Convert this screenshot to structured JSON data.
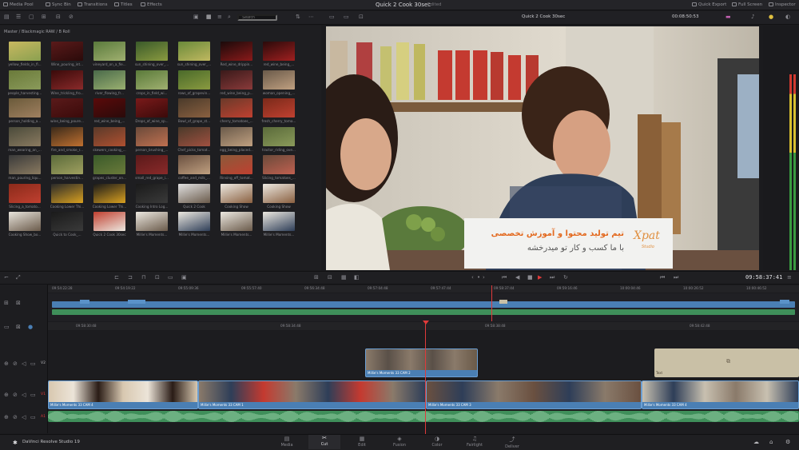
{
  "topbar": {
    "media_pool": "Media Pool",
    "sync_bin": "Sync Bin",
    "transitions": "Transitions",
    "titles": "Titles",
    "effects": "Effects",
    "project_title": "Quick 2 Cook 30sec",
    "edited": "Edited",
    "quick_export": "Quick Export",
    "full_screen": "Full Screen",
    "inspector": "Inspector"
  },
  "toolbar": {
    "search_placeholder": "Search",
    "viewer_clip": "Quick 2 Cook 30sec",
    "viewer_timecode": "00:08:50:53"
  },
  "pool": {
    "path": "Master / Blackmagic RAW / B Roll",
    "clips": [
      "yellow_fields_in_fl...",
      "Wine_pouring_int...",
      "vineyard_on_a_fie...",
      "sun_shining_over_...",
      "sun_shining_over_...",
      "Red_wine_drippin...",
      "red_wine_being_...",
      "people_harvesting...",
      "Wine_trickling_fro...",
      "river_flowing_fr...",
      "crops_in_field_wi...",
      "rows_of_grapevin...",
      "red_wine_being_p...",
      "woman_opening_...",
      "person_holding_a...",
      "wine_being_poure...",
      "red_wine_being_...",
      "Drops_of_wine_sp...",
      "Bowl_of_grape_st...",
      "cherry_tomatoes_...",
      "fresh_cherry_toma...",
      "man_wearing_an_...",
      "fire_and_smoke_r...",
      "skewers_cooking_...",
      "person_brushing_...",
      "Chef_picks_tomat...",
      "egg_being_placed...",
      "tractor_riding_ove...",
      "man_pouring_liqu...",
      "person_harvestin...",
      "grapes_cluster_on...",
      "small_red_grape_i...",
      "coffee_and_milk_...",
      "Rinsing_off_tomat...",
      "Slicing_tomatoes_...",
      "Slicing_a_tomato...",
      "Cooking Lower Thi...",
      "Cooking Lower Thi...",
      "Cooking Intro Log...",
      "Quick 2 Cook",
      "Cooking Show",
      "Cooking Show",
      "Cooking Show_bo...",
      "Quick to Cook_...",
      "Quick 2 Cook 30sec",
      "Millie's Moments...",
      "Millie's Moments...",
      "Millie's Moments...",
      "Millie's Moments..."
    ]
  },
  "overlay": {
    "line1": "تیم تولید محتوا و آموزش تخصصی",
    "line2": "با ما کسب و کار تو  میدرخشه",
    "logo": "Xpat",
    "logo_sub": "Studio"
  },
  "transport": {
    "timecode": "09:58:37:41"
  },
  "ruler_top": [
    "09:54:22:28",
    "09:54:19:22",
    "09:55:09:36",
    "09:55:57:40",
    "09:56:34:48",
    "09:57:04:48",
    "09:57:47:44",
    "09:58:37:44",
    "09:59:16:46",
    "10:00:04:46",
    "10:00:26:52",
    "10:00:46:52"
  ],
  "ruler_main": [
    "09:58:30:48",
    "09:58:34:48",
    "09:58:38:48",
    "09:58:42:48"
  ],
  "tracks": {
    "v2": "V2",
    "v1": "V1",
    "a1": "A1",
    "clip_v2": "Millie's Moments 33 CAM 2",
    "clip_v1a": "Millie's Moments 33 CAM 4",
    "clip_v1b": "Millie's Moments 33 CAM 1",
    "clip_v1c": "Millie's Moments 33 CAM 3",
    "clip_v1d": "Millie's Moments 33 CAM 4",
    "clip_text": "Text"
  },
  "bottom": {
    "app_name": "DaVinci Resolve Studio 19",
    "pages": [
      "Media",
      "Cut",
      "Edit",
      "Fusion",
      "Color",
      "Fairlight",
      "Deliver"
    ]
  },
  "colors": {
    "accent_red": "#e03a3a",
    "clip_blue": "#4a7fb4",
    "audio_green": "#3f8f5a",
    "text_clip": "#c9c0a6"
  }
}
